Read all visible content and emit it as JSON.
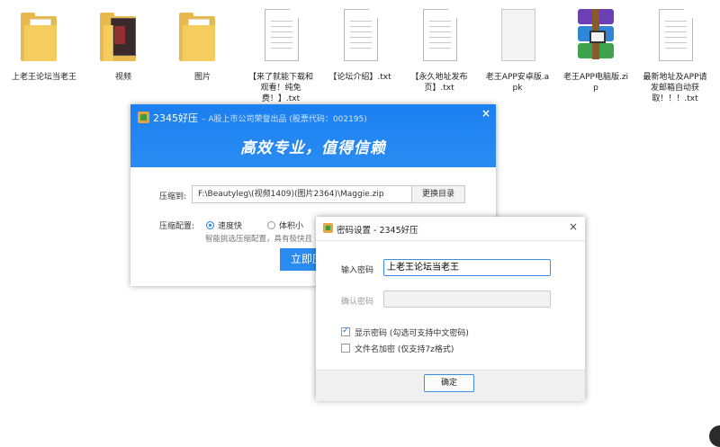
{
  "desktop": {
    "files": [
      {
        "name": "上老王论坛当老王",
        "icon": "folder-icon"
      },
      {
        "name": "视频",
        "icon": "video-folder-icon"
      },
      {
        "name": "图片",
        "icon": "folder-icon"
      },
      {
        "name": "【来了就能下载和观看！纯免费！】.txt",
        "icon": "text-file-icon"
      },
      {
        "name": "【论坛介绍】.txt",
        "icon": "text-file-icon"
      },
      {
        "name": "【永久地址发布页】.txt",
        "icon": "text-file-icon"
      },
      {
        "name": "老王APP安卓版.apk",
        "icon": "apk-file-icon"
      },
      {
        "name": "老王APP电脑版.zip",
        "icon": "winrar-archive-icon"
      },
      {
        "name": "最新地址及APP请发邮箱自动获取！！！.txt",
        "icon": "text-file-icon"
      }
    ]
  },
  "main_dialog": {
    "title": "2345好压",
    "subtitle": "– A股上市公司荣誉出品 (股票代码：002195)",
    "close": "×",
    "slogan": "高效专业，值得信赖",
    "compress_to_label": "压缩到:",
    "path_value": "F:\\Beautyleg\\(视频1409)(图片2364)\\Maggie.zip",
    "change_dir_label": "更换目录",
    "config_label": "压缩配置:",
    "option_fast": "速度快",
    "option_small": "体积小",
    "option_fast_selected": true,
    "hint": "智能挑选压缩配置，具有极快且",
    "start_button": "立即压"
  },
  "password_dialog": {
    "title": "密码设置 - 2345好压",
    "close": "×",
    "enter_label": "输入密码",
    "enter_value": "上老王论坛当老王",
    "confirm_label": "确认密码",
    "confirm_value": "",
    "show_password_label": "显示密码 (勾选可支持中文密码)",
    "show_password_checked": true,
    "encrypt_names_label": "文件名加密 (仅支持7z格式)",
    "encrypt_names_checked": false,
    "ok_button": "确定"
  },
  "colors": {
    "accent": "#2a8cf2",
    "header_blue": "#1b7ff0",
    "folder": "#f5cd5f"
  }
}
